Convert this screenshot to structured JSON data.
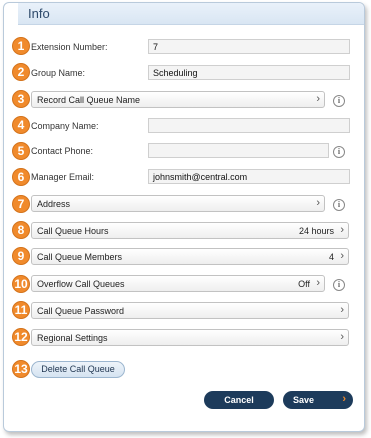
{
  "panel": {
    "title": "Info"
  },
  "badges": [
    "1",
    "2",
    "3",
    "4",
    "5",
    "6",
    "7",
    "8",
    "9",
    "10",
    "11",
    "12",
    "13"
  ],
  "fields": {
    "extension": {
      "label": "Extension Number:",
      "value": "7"
    },
    "group": {
      "label": "Group Name:",
      "value": "Scheduling"
    },
    "company": {
      "label": "Company Name:",
      "value": ""
    },
    "phone": {
      "label": "Contact Phone:",
      "value": ""
    },
    "email": {
      "label": "Manager Email:",
      "value": "johnsmith@central.com"
    }
  },
  "rows": {
    "record": {
      "label": "Record Call Queue Name",
      "value": ""
    },
    "address": {
      "label": "Address",
      "value": ""
    },
    "hours": {
      "label": "Call Queue Hours",
      "value": "24 hours"
    },
    "members": {
      "label": "Call Queue Members",
      "value": "4"
    },
    "overflow": {
      "label": "Overflow Call Queues",
      "value": "Off"
    },
    "password": {
      "label": "Call Queue Password",
      "value": ""
    },
    "regional": {
      "label": "Regional Settings",
      "value": ""
    }
  },
  "info_icon": "i",
  "chevron": "›",
  "buttons": {
    "delete": "Delete Call Queue",
    "cancel": "Cancel",
    "save": "Save"
  },
  "colors": {
    "badge": "#f08a2c",
    "primary_button": "#1d3b5b",
    "header": "#d9e6f3"
  }
}
